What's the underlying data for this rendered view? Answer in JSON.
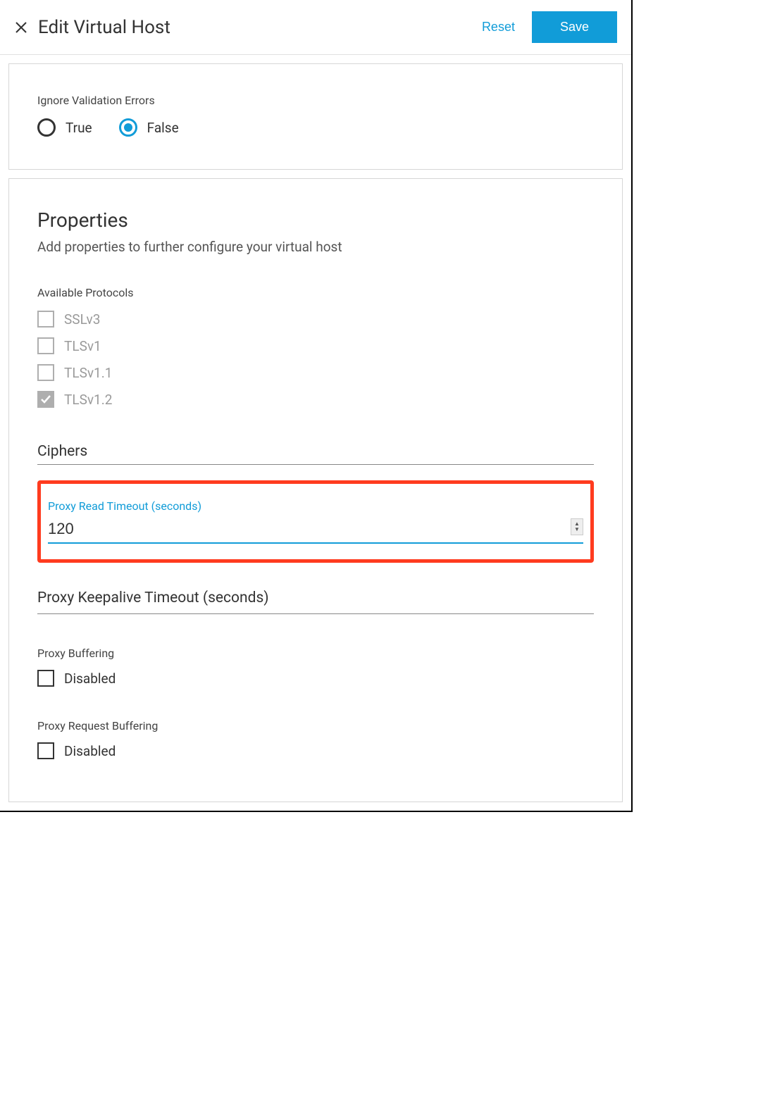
{
  "header": {
    "title": "Edit Virtual Host",
    "reset_label": "Reset",
    "save_label": "Save"
  },
  "ignore_validation": {
    "label": "Ignore Validation Errors",
    "options": {
      "true": "True",
      "false": "False"
    },
    "selected": "false"
  },
  "properties": {
    "title": "Properties",
    "subtitle": "Add properties to further configure your virtual host",
    "available_protocols_label": "Available Protocols",
    "protocols": [
      {
        "label": "SSLv3",
        "checked": false
      },
      {
        "label": "TLSv1",
        "checked": false
      },
      {
        "label": "TLSv1.1",
        "checked": false
      },
      {
        "label": "TLSv1.2",
        "checked": true
      }
    ],
    "ciphers_label": "Ciphers",
    "proxy_read_timeout": {
      "label": "Proxy Read Timeout (seconds)",
      "value": "120"
    },
    "proxy_keepalive_label": "Proxy Keepalive Timeout (seconds)",
    "proxy_buffering": {
      "label": "Proxy Buffering",
      "option": "Disabled",
      "checked": false
    },
    "proxy_request_buffering": {
      "label": "Proxy Request Buffering",
      "option": "Disabled",
      "checked": false
    }
  }
}
